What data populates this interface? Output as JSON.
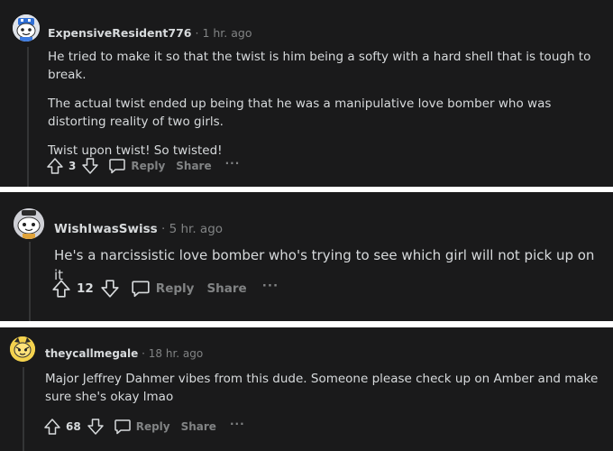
{
  "comments": [
    {
      "username": "ExpensiveResident776",
      "separator": "·",
      "time": "1 hr. ago",
      "paragraphs": [
        "He tried to make it so that the twist is him being a softy with a hard shell that is tough to break.",
        "The actual twist ended up being that he was a manipulative love bomber who was distorting reality of two girls.",
        "Twist upon twist! So twisted!"
      ],
      "score": "3",
      "reply_label": "Reply",
      "share_label": "Share",
      "more_label": "···"
    },
    {
      "username": "WishIwasSwiss",
      "separator": "·",
      "time": "5 hr. ago",
      "paragraphs": [
        "He's a narcissistic love bomber who's trying to see which girl will not pick up on it"
      ],
      "score": "12",
      "reply_label": "Reply",
      "share_label": "Share",
      "more_label": "···"
    },
    {
      "username": "theycallmegale",
      "separator": "·",
      "time": "18 hr. ago",
      "paragraphs": [
        "Major Jeffrey Dahmer vibes from this dude. Someone please check up on Amber and make sure she's okay lmao"
      ],
      "score": "68",
      "reply_label": "Reply",
      "share_label": "Share",
      "more_label": "···"
    }
  ],
  "theme": {
    "card_bg": "#1a1a1b",
    "text": "#d7dadc",
    "muted": "#818384",
    "gap": "#ffffff"
  }
}
